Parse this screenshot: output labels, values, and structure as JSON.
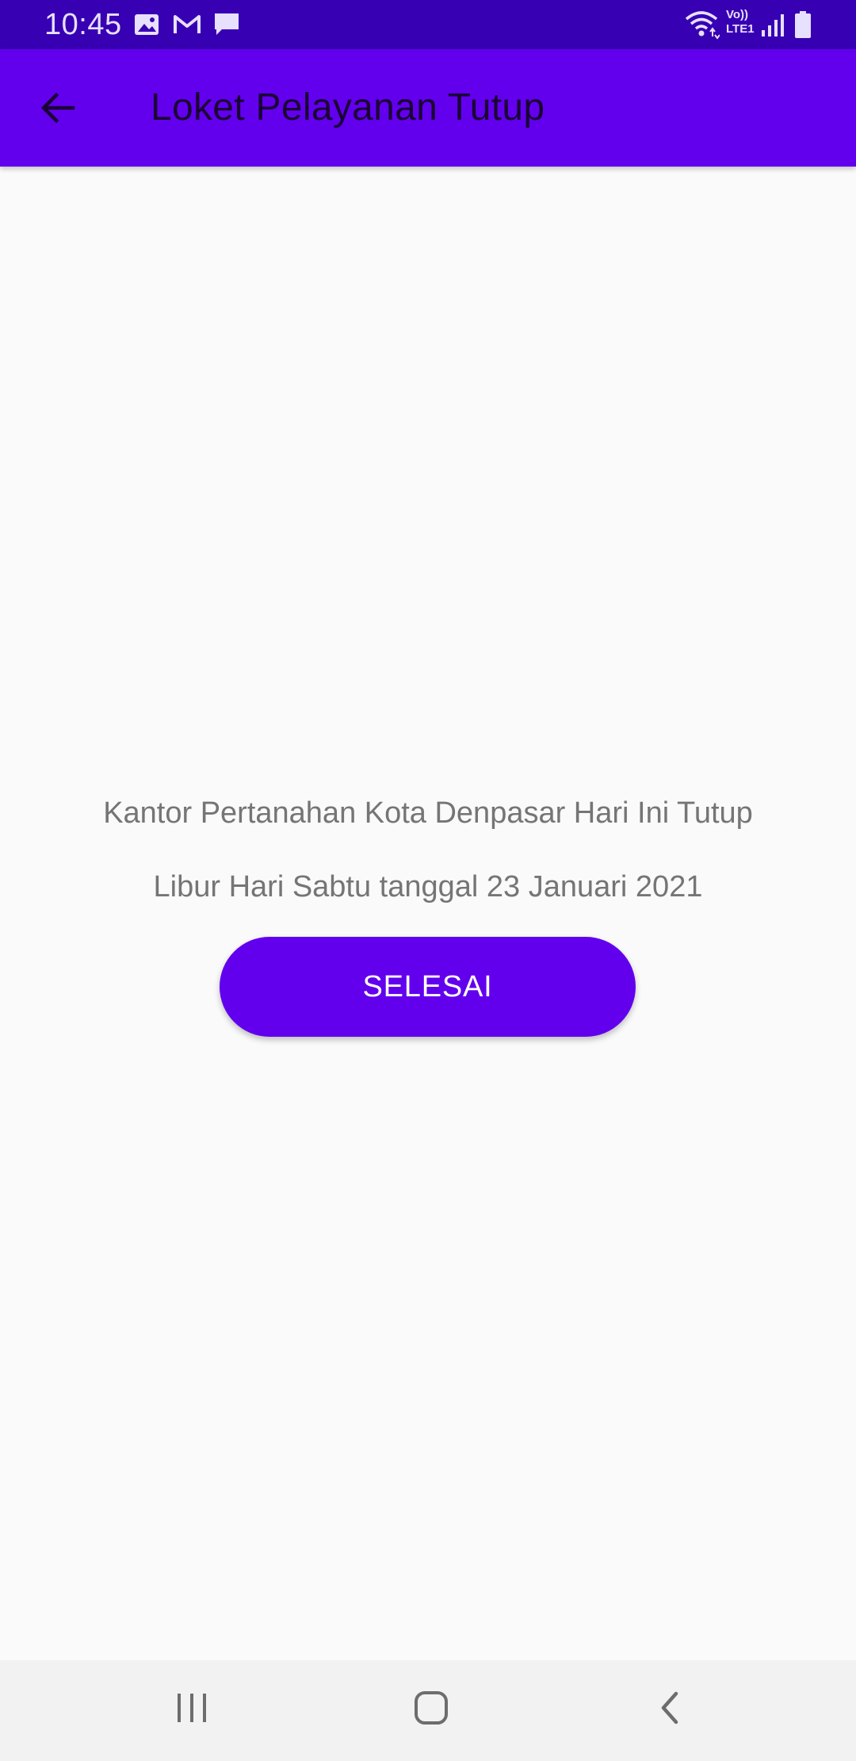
{
  "status_bar": {
    "time": "10:45",
    "icons": [
      "image-icon",
      "gmail-icon",
      "message-icon",
      "wifi-icon",
      "volte-icon",
      "signal-icon",
      "battery-icon"
    ],
    "volte_label": "Vo))",
    "lte_label": "LTE1"
  },
  "app_bar": {
    "title": "Loket Pelayanan Tutup",
    "back_icon": "arrow-left-icon",
    "color": "#6200ee"
  },
  "content": {
    "message_line_1": "Kantor Pertanahan Kota Denpasar Hari Ini Tutup",
    "message_line_2": "Libur Hari Sabtu tanggal 23 Januari 2021",
    "button_label": "SELESAI"
  },
  "nav_bar": {
    "buttons": [
      "recent-apps-icon",
      "home-icon",
      "back-icon"
    ]
  },
  "colors": {
    "status_bar": "#3700b3",
    "primary": "#6200ee",
    "background": "#fafafa",
    "text_secondary": "#757575"
  }
}
